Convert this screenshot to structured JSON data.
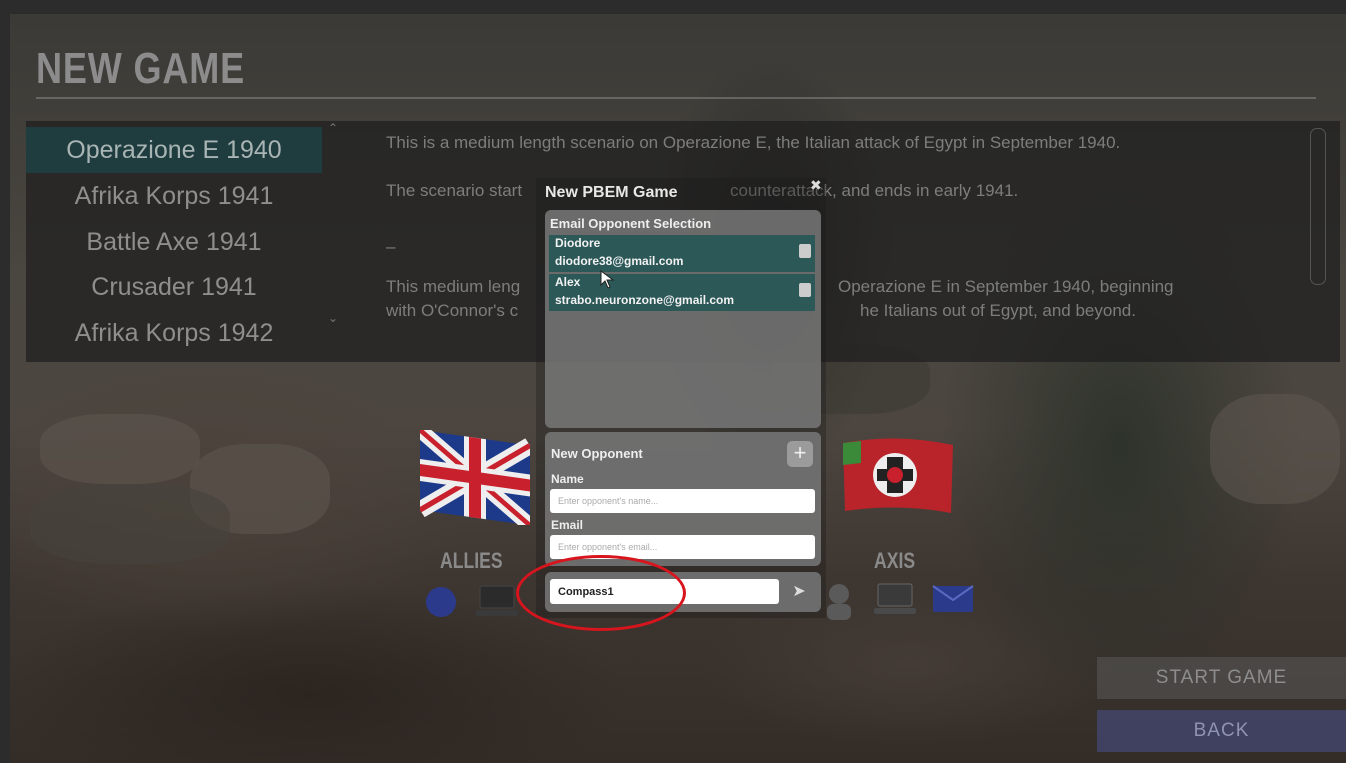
{
  "header": {
    "title": "NEW GAME"
  },
  "scenarios": {
    "items": [
      {
        "label": "Operazione E 1940",
        "selected": true
      },
      {
        "label": "Afrika Korps 1941",
        "selected": false
      },
      {
        "label": "Battle Axe 1941",
        "selected": false
      },
      {
        "label": "Crusader 1941",
        "selected": false
      },
      {
        "label": "Afrika Korps 1942",
        "selected": false
      }
    ]
  },
  "description": {
    "line1": "This is a medium length scenario on Operazione E, the Italian attack of Egypt in September 1940.",
    "line2a": "The scenario start",
    "line2b": "counterattack, and ends in early 1941.",
    "line3": "–",
    "line4a": "This medium leng",
    "line4b": "Operazione E in September 1940, beginning",
    "line5a": "with O'Connor's c",
    "line5b": "he Italians out of Egypt, and beyond."
  },
  "modal": {
    "title": "New PBEM Game",
    "close_icon": "close-icon",
    "opponent_selection": {
      "header": "Email Opponent Selection",
      "opponents": [
        {
          "name": "Diodore",
          "email": "diodore38@gmail.com"
        },
        {
          "name": "Alex",
          "email": "strabo.neuronzone@gmail.com"
        }
      ]
    },
    "new_opponent": {
      "header": "New Opponent",
      "add_label": "+",
      "name_label": "Name",
      "name_placeholder": "Enter opponent's name...",
      "email_label": "Email",
      "email_placeholder": "Enter opponent's email..."
    },
    "game_name": {
      "value": "Compass1",
      "send_icon": "send-arrow-icon"
    }
  },
  "sides": {
    "allies_label": "ALLIES",
    "axis_label": "AXIS"
  },
  "buttons": {
    "start_game": "START GAME",
    "back": "BACK"
  },
  "colors": {
    "selected_scenario_bg": "#1f3c3e",
    "opponent_row_bg": "#2c5858",
    "highlight_circle": "#d8141d",
    "back_button": "#464a78"
  }
}
